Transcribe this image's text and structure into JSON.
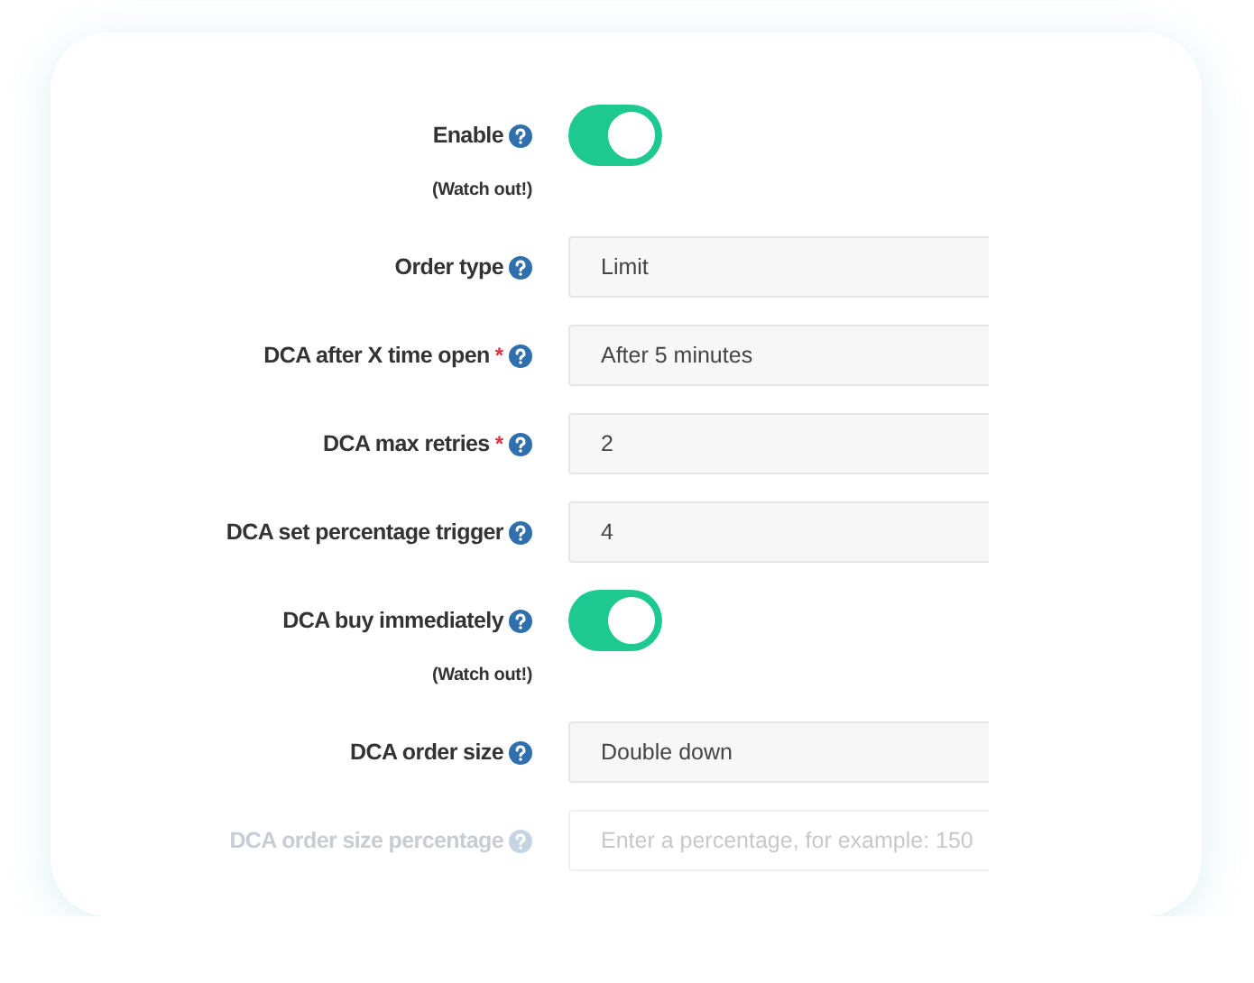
{
  "fields": [
    {
      "kind": "toggle",
      "label": "Enable",
      "note": "(Watch out!)",
      "on": true,
      "disabled": false
    },
    {
      "kind": "input",
      "label": "Order type",
      "value": "Limit",
      "disabled": false
    },
    {
      "kind": "input",
      "label": "DCA after X time open",
      "required_mark": "*",
      "value": "After 5 minutes",
      "disabled": false
    },
    {
      "kind": "input",
      "label": "DCA max retries",
      "required_mark": "*",
      "value": "2",
      "disabled": false
    },
    {
      "kind": "input",
      "label": "DCA set percentage trigger",
      "value": "4",
      "disabled": false
    },
    {
      "kind": "toggle",
      "label": "DCA buy immediately",
      "note": "(Watch out!)",
      "on": true,
      "disabled": false
    },
    {
      "kind": "input",
      "label": "DCA order size",
      "value": "Double down",
      "disabled": false
    },
    {
      "kind": "input",
      "label": "DCA order size percentage",
      "placeholder": "Enter a percentage, for example: 150",
      "disabled": true
    }
  ]
}
